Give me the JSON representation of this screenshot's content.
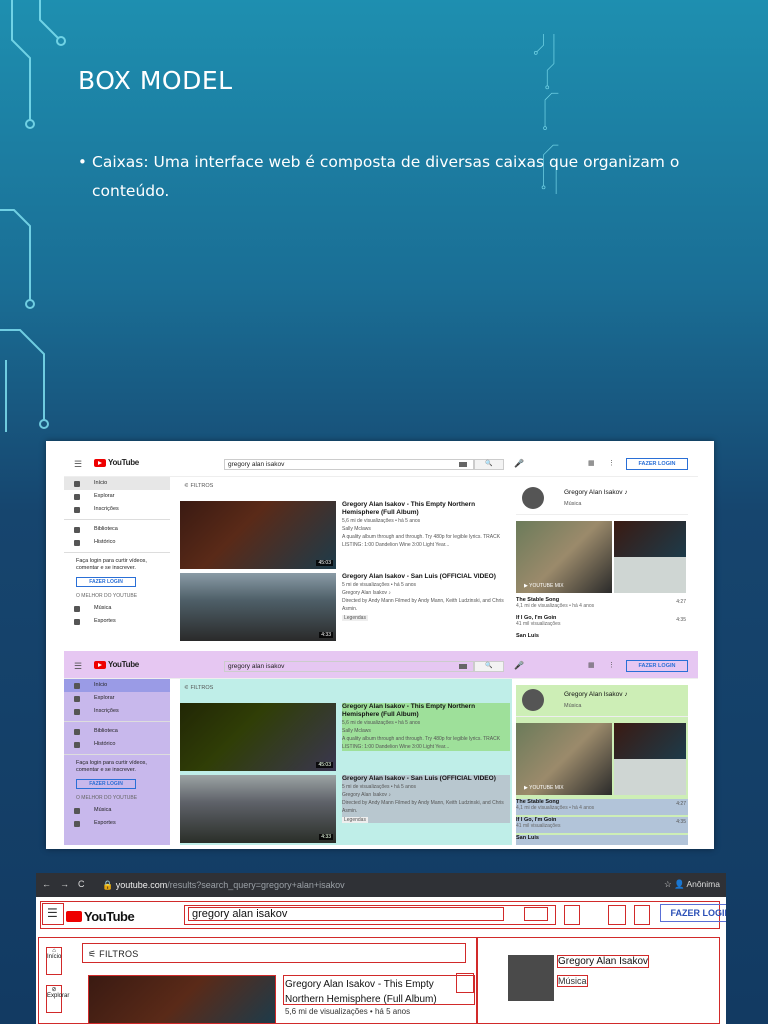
{
  "slide": {
    "title": "BOX MODEL",
    "bullet": "Caixas: Uma interface web é composta de diversas caixas que organizam o conteúdo."
  },
  "youtube": {
    "logo": "YouTube",
    "search_query": "gregory alan isakov",
    "login_label": "FAZER LOGIN",
    "sidebar": {
      "items": [
        {
          "label": "Início",
          "icon": "home-icon"
        },
        {
          "label": "Explorar",
          "icon": "compass-icon"
        },
        {
          "label": "Inscrições",
          "icon": "subscriptions-icon"
        }
      ],
      "items2": [
        {
          "label": "Biblioteca",
          "icon": "library-icon"
        },
        {
          "label": "Histórico",
          "icon": "history-icon"
        }
      ],
      "login_message": "Faça login para curtir vídeos, comentar e se inscrever.",
      "section_title": "O MELHOR DO YOUTUBE",
      "items3": [
        {
          "label": "Música",
          "icon": "music-icon"
        },
        {
          "label": "Esportes",
          "icon": "trophy-icon"
        }
      ]
    },
    "filters_label": "FILTROS",
    "videos": [
      {
        "title": "Gregory Alan Isakov - This Empty Northern Hemisphere (Full Album)",
        "views": "5,6 mi de visualizações • há 5 anos",
        "channel": "Sally Mclaws",
        "desc": "A quality album through and through. Try 480p for legible lyrics. TRACK LISTING: 1:00 Dandelion Wine 3:00 Light Year...",
        "duration": "45:03"
      },
      {
        "title": "Gregory Alan Isakov - San Luis (OFFICIAL VIDEO)",
        "views": "5 mi de visualizações • há 5 anos",
        "channel": "Gregory Alan Isakov ♪",
        "desc": "Directed by Andy Mann Filmed by Andy Mann, Keith Ludzinski, and Chris Asmin.",
        "badge": "Legendas",
        "duration": "4:33"
      }
    ],
    "channel_card": {
      "name": "Gregory Alan Isakov ♪",
      "sub": "Música"
    },
    "mix_label": "▶ YOUTUBE MIX",
    "songs": [
      {
        "title": "The Stable Song",
        "count": "4,1 mi de visualizações • há 4 anos",
        "duration": "4:27"
      },
      {
        "title": "If I Go, I'm Goin",
        "count": "41 mil visualizações",
        "duration": "4:35"
      },
      {
        "title": "San Luis",
        "count": "",
        "duration": ""
      }
    ]
  },
  "browser": {
    "url_host": "youtube.com",
    "url_path": "/results?search_query=gregory+alan+isakov",
    "incognito": "Anônima",
    "logo": "YouTube",
    "search_query": "gregory alan isakov",
    "login_label": "FAZER LOGIN",
    "side_item": "Início",
    "side_item2": "Explorar",
    "filters_label": "FILTROS",
    "video_title_line1": "Gregory Alan Isakov - This Empty",
    "video_title_line2": "Northern Hemisphere (Full Album)",
    "video_views": "5,6 mi de visualizações • há 5 anos",
    "channel_name": "Gregory Alan Isakov",
    "channel_sub": "Música"
  }
}
